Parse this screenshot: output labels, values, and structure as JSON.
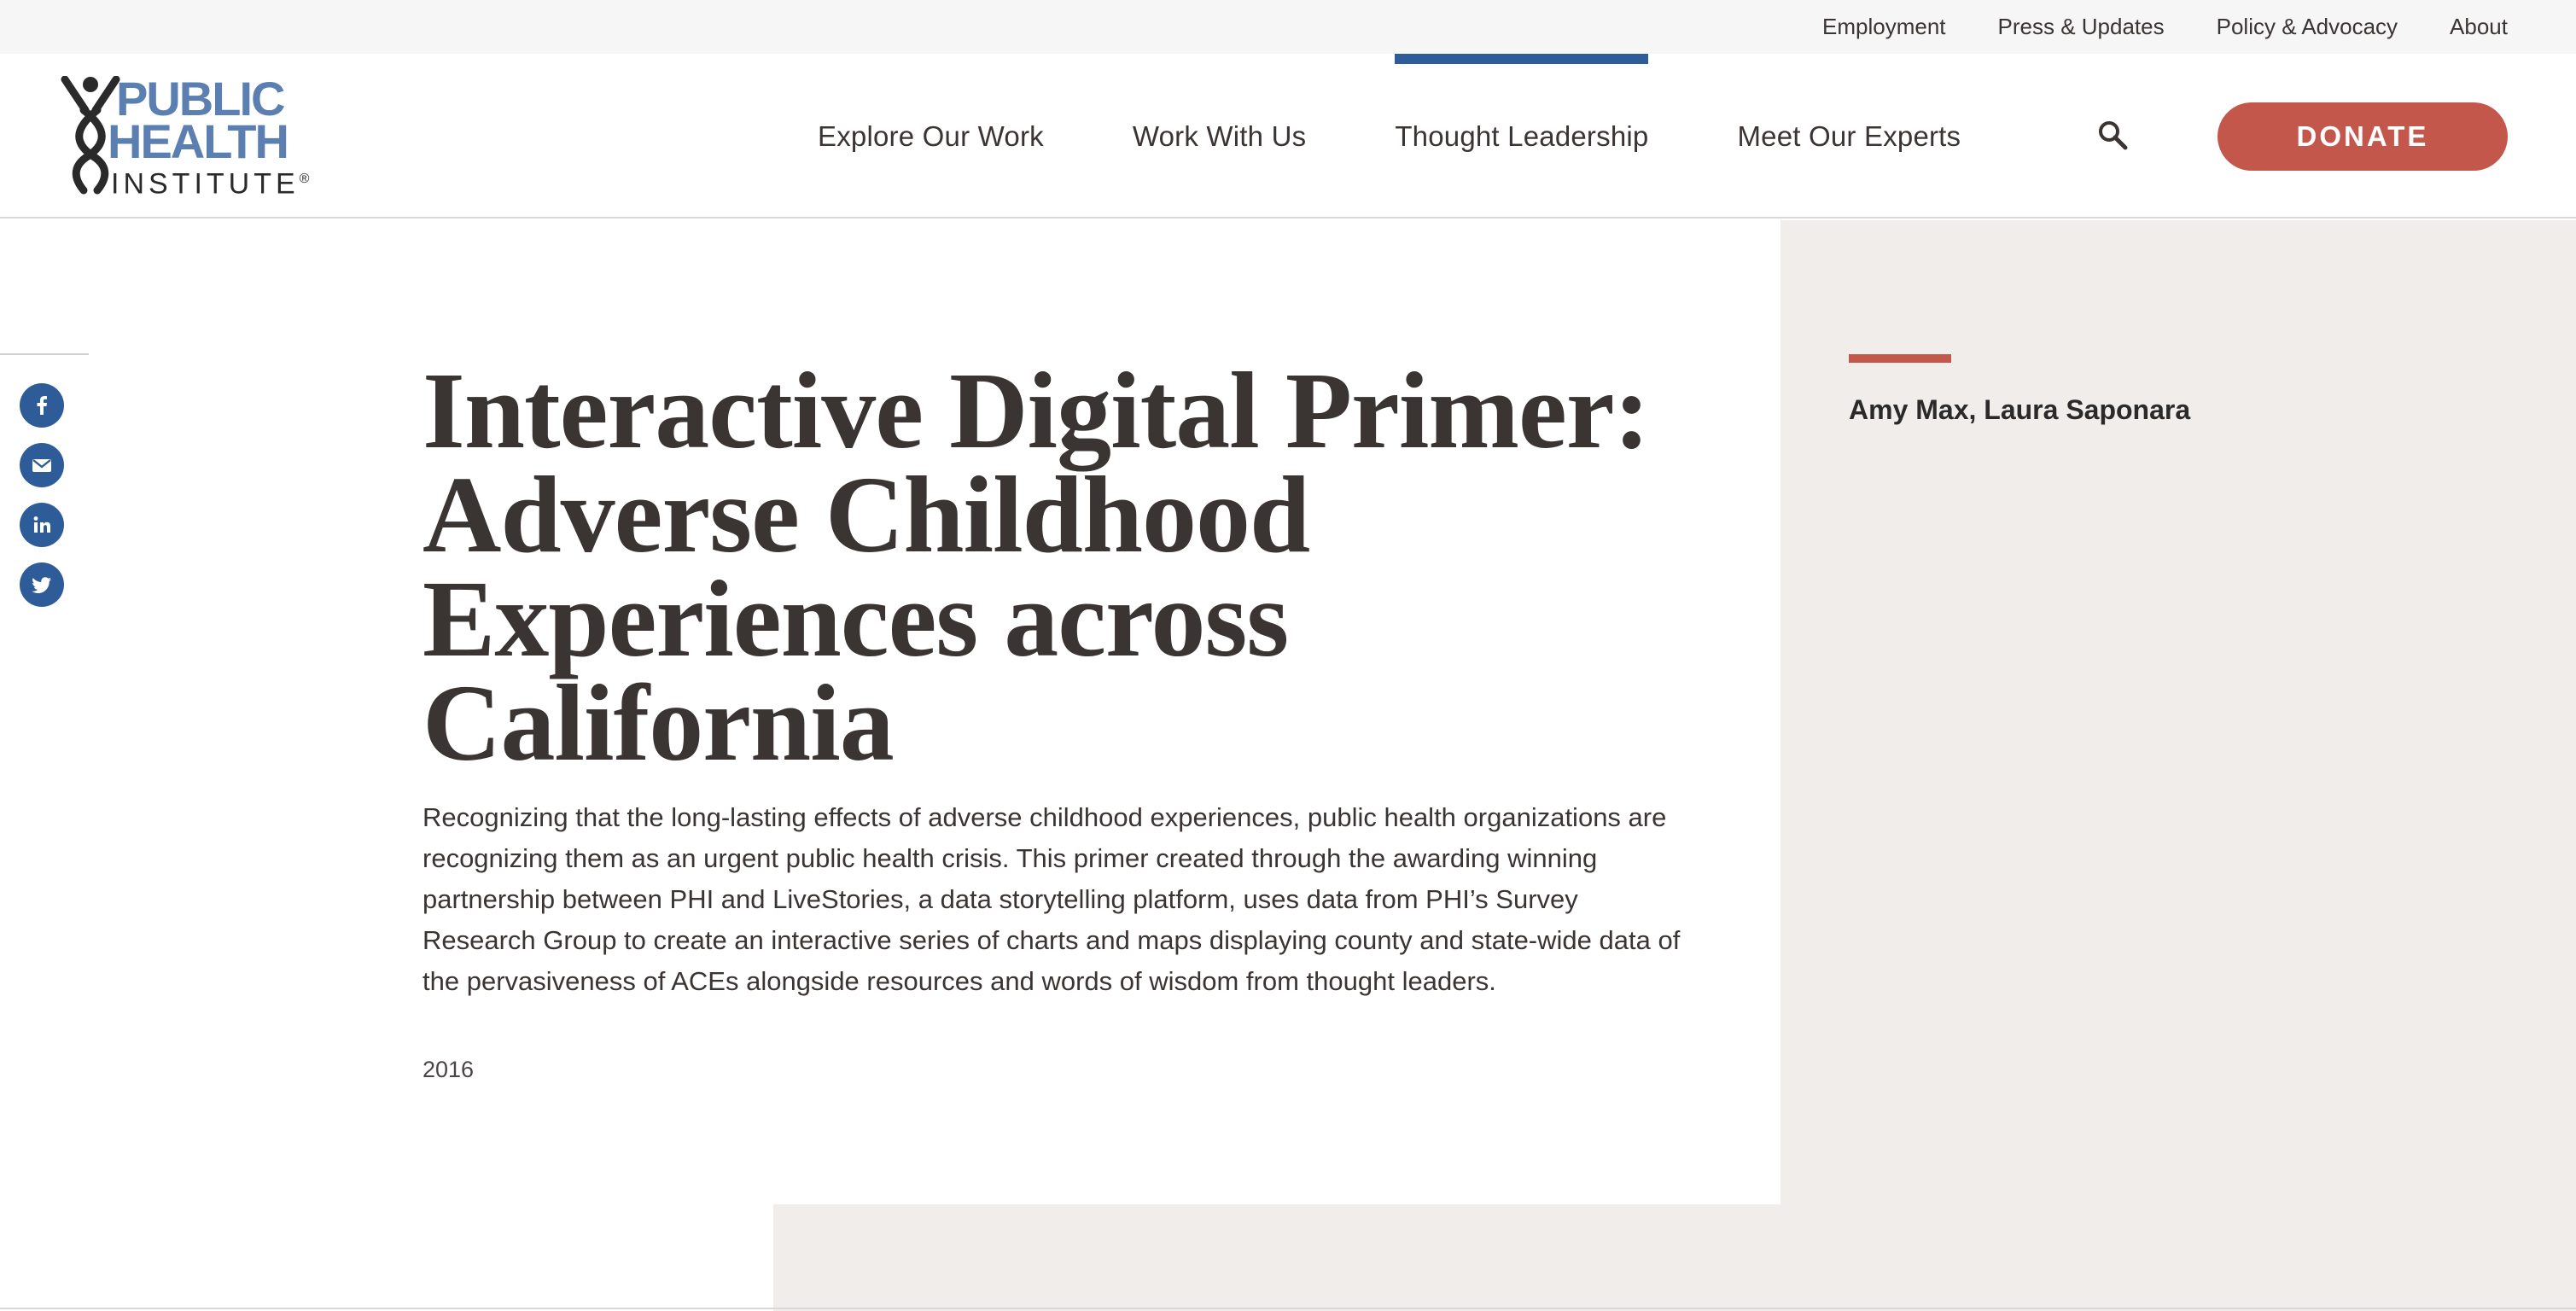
{
  "utility_nav": {
    "items": [
      "Employment",
      "Press & Updates",
      "Policy & Advocacy",
      "About"
    ]
  },
  "logo": {
    "line1": "PUBLIC",
    "line2": "HEALTH",
    "line3": "INSTITUTE",
    "reg": "®"
  },
  "main_nav": {
    "items": [
      "Explore Our Work",
      "Work With Us",
      "Thought Leadership",
      "Meet Our Experts"
    ],
    "active": "Thought Leadership",
    "search_icon": "search-icon",
    "donate_label": "DONATE"
  },
  "share": {
    "icons": [
      "facebook-icon",
      "email-icon",
      "linkedin-icon",
      "twitter-icon"
    ]
  },
  "article": {
    "title": "Interactive Digital Primer: Adverse Childhood Experiences across California",
    "summary": "Recognizing that the long-lasting effects of adverse childhood experiences, public health organizations are recognizing them as an urgent public health crisis. This primer created through the awarding winning partnership between PHI and LiveStories, a data storytelling platform, uses data from PHI’s Survey Research Group to create an interactive series of charts and maps displaying county and state-wide data of the pervasiveness of ACEs alongside resources and words of wisdom from thought leaders.",
    "year": "2016"
  },
  "sidebar": {
    "authors": "Amy Max, Laura Saponara"
  },
  "colors": {
    "brand_blue": "#2e5c99",
    "logo_blue": "#5a7fb0",
    "donate_red": "#c4574b",
    "panel_beige": "#f1edea"
  }
}
